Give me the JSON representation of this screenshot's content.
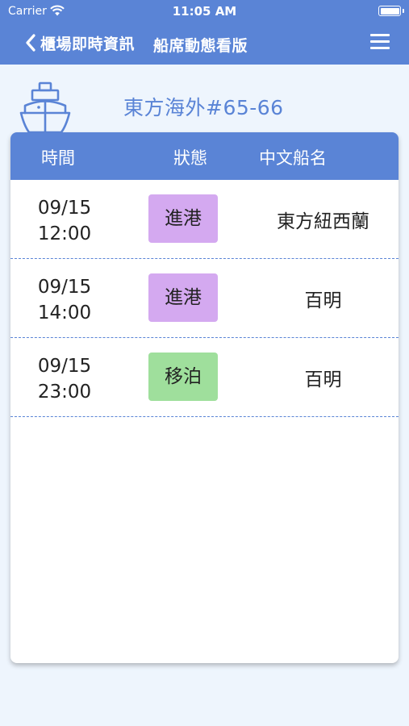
{
  "status_bar": {
    "carrier": "Carrier",
    "time": "11:05 AM",
    "wifi_icon": "wifi-icon",
    "battery_icon": "battery-full-icon"
  },
  "nav": {
    "back_label": "櫃場即時資訊",
    "title": "船席動態看版",
    "back_icon": "chevron-left-icon",
    "menu_icon": "hamburger-menu-icon"
  },
  "vessel": {
    "icon": "ship-icon",
    "title": "東方海外#65-66"
  },
  "table": {
    "headers": {
      "time": "時間",
      "status": "狀態",
      "ship_name": "中文船名"
    },
    "rows": [
      {
        "date": "09/15",
        "time": "12:00",
        "status": "進港",
        "status_color": "#d4a9f0",
        "ship_name": "東方紐西蘭"
      },
      {
        "date": "09/15",
        "time": "14:00",
        "status": "進港",
        "status_color": "#d4a9f0",
        "ship_name": "百明"
      },
      {
        "date": "09/15",
        "time": "23:00",
        "status": "移泊",
        "status_color": "#9fdf9c",
        "ship_name": "百明"
      }
    ]
  },
  "colors": {
    "brand": "#5a84d6",
    "background": "#eef5fd",
    "status_in_port": "#d4a9f0",
    "status_shift": "#9fdf9c"
  }
}
